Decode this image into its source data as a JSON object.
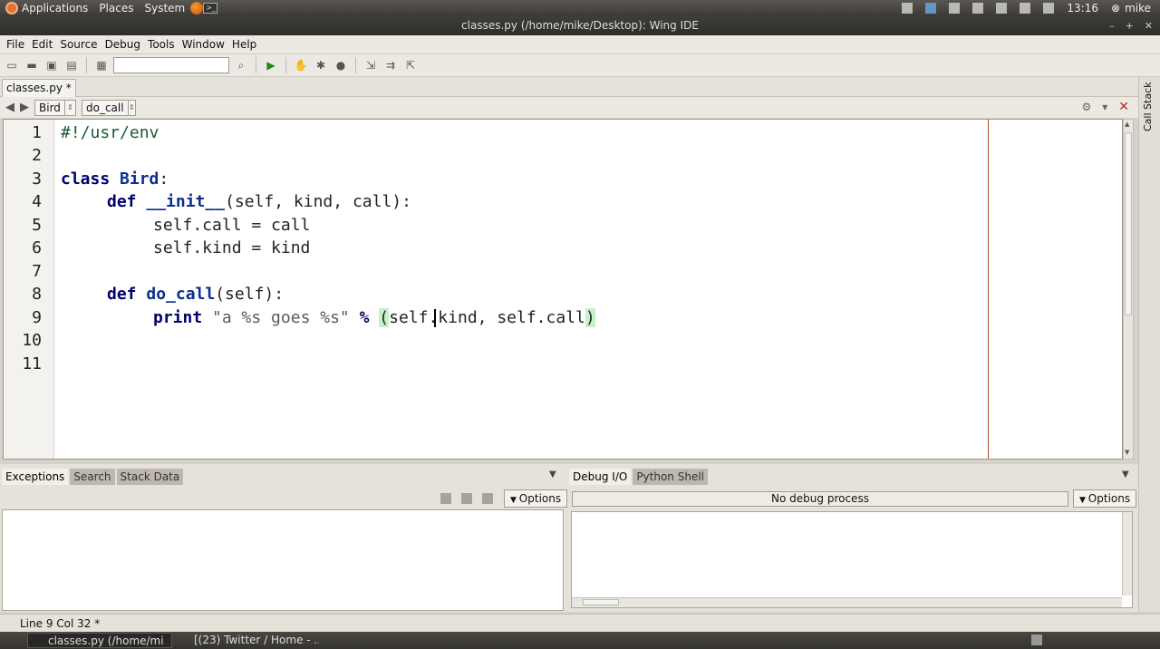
{
  "panel": {
    "menus": [
      "Applications",
      "Places",
      "System"
    ],
    "clock": "13:16",
    "user": "mike"
  },
  "window": {
    "title": "classes.py (/home/mike/Desktop): Wing IDE"
  },
  "menubar": [
    "File",
    "Edit",
    "Source",
    "Debug",
    "Tools",
    "Window",
    "Help"
  ],
  "editor": {
    "tab_label": "classes.py *",
    "class_combo": "Bird",
    "method_combo": "do_call",
    "line_numbers": [
      "1",
      "2",
      "3",
      "4",
      "5",
      "6",
      "7",
      "8",
      "9",
      "10",
      "11"
    ],
    "lines": {
      "l1": "#!/usr/env",
      "l3_kw": "class",
      "l3_name": "Bird",
      "l3_rest": ":",
      "l4_kw": "def",
      "l4_name": "__init__",
      "l4_rest": "(self, kind, call):",
      "l5": "self.call = call",
      "l6": "self.kind = kind",
      "l8_kw": "def",
      "l8_name": "do_call",
      "l8_rest": "(self):",
      "l9_kw": "print",
      "l9_str": "\"a %s goes %s\"",
      "l9_op": "%",
      "l9_open": "(",
      "l9_args": "self.kind, self.call",
      "l9_close": ")"
    }
  },
  "sidebar": {
    "call_stack_label": "Call Stack"
  },
  "bottom_left": {
    "tabs": [
      "Exceptions",
      "Search",
      "Stack Data"
    ],
    "options_label": "Options"
  },
  "bottom_right": {
    "tabs": [
      "Debug I/O",
      "Python Shell"
    ],
    "status": "No debug process",
    "options_label": "Options"
  },
  "status": {
    "position": "Line 9 Col 32 *"
  },
  "taskbar": {
    "items": [
      "classes.py (/home/mi",
      "[(23) Twitter / Home - ..."
    ]
  }
}
